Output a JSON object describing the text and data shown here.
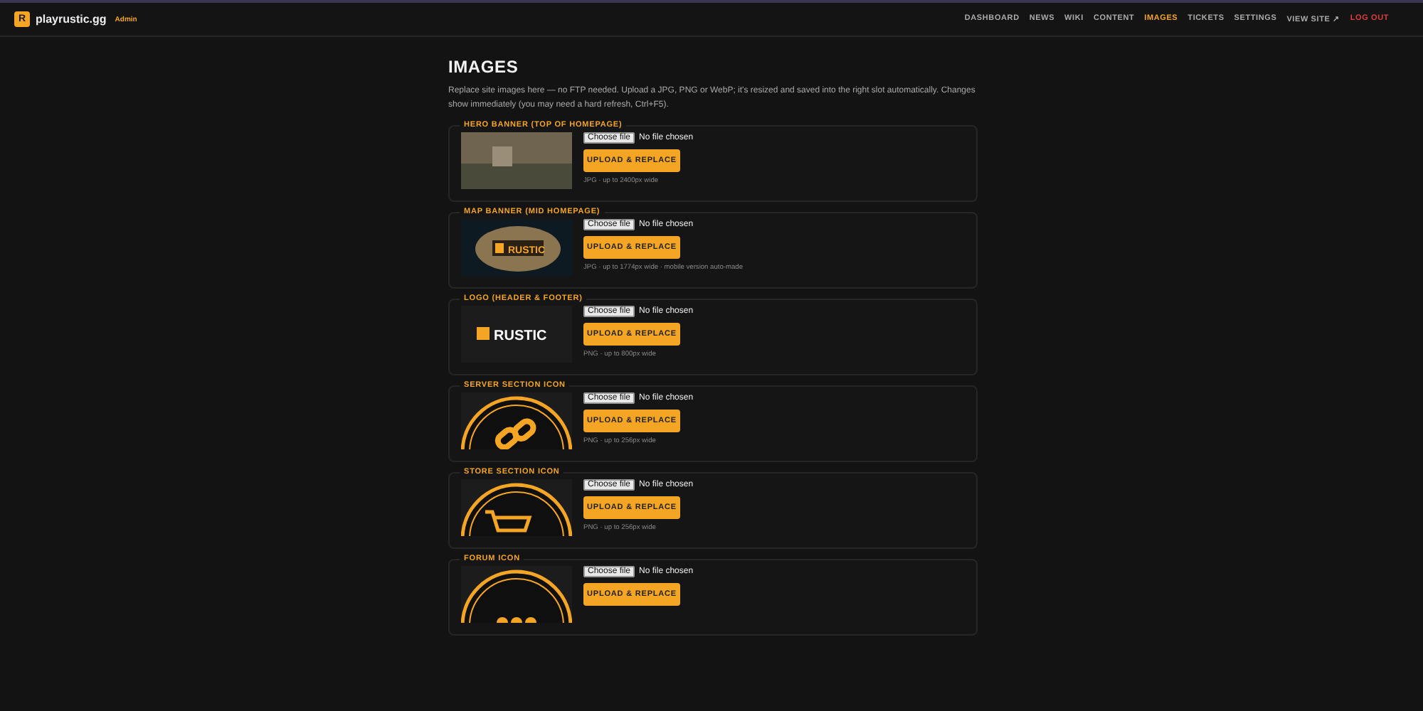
{
  "brand": {
    "logo_letter": "R",
    "name": "playrustic.gg",
    "badge": "Admin"
  },
  "nav": [
    {
      "label": "DASHBOARD",
      "kind": "link",
      "selected": false
    },
    {
      "label": "NEWS",
      "kind": "link",
      "selected": false
    },
    {
      "label": "WIKI",
      "kind": "link",
      "selected": false
    },
    {
      "label": "CONTENT",
      "kind": "link",
      "selected": false
    },
    {
      "label": "IMAGES",
      "kind": "link",
      "selected": true
    },
    {
      "label": "TICKETS",
      "kind": "link",
      "selected": false
    },
    {
      "label": "SETTINGS",
      "kind": "link",
      "selected": false
    },
    {
      "label": "VIEW SITE ↗",
      "kind": "link",
      "selected": false
    },
    {
      "label": "LOG OUT",
      "kind": "logout",
      "selected": false
    }
  ],
  "page": {
    "title": "IMAGES",
    "description": "Replace site images here — no FTP needed. Upload a JPG, PNG or WebP; it's resized and saved into the right slot automatically. Changes show immediately (you may need a hard refresh, Ctrl+F5)."
  },
  "slots": [
    {
      "title": "HERO BANNER (TOP OF HOMEPAGE)",
      "kind": "photo",
      "choose_label": "Choose file",
      "file_status": "No file chosen",
      "button": "UPLOAD & REPLACE",
      "hint": "JPG · up to 2400px wide"
    },
    {
      "title": "MAP BANNER (MID HOMEPAGE)",
      "kind": "map",
      "preview_text": "RUSTIC",
      "choose_label": "Choose file",
      "file_status": "No file chosen",
      "button": "UPLOAD & REPLACE",
      "hint": "JPG · up to 1774px wide · mobile version auto-made"
    },
    {
      "title": "LOGO (HEADER & FOOTER)",
      "kind": "logo",
      "preview_text": "RUSTIC",
      "choose_label": "Choose file",
      "file_status": "No file chosen",
      "button": "UPLOAD & REPLACE",
      "hint": "PNG · up to 800px wide"
    },
    {
      "title": "SERVER SECTION ICON",
      "kind": "chain",
      "choose_label": "Choose file",
      "file_status": "No file chosen",
      "button": "UPLOAD & REPLACE",
      "hint": "PNG · up to 256px wide"
    },
    {
      "title": "STORE SECTION ICON",
      "kind": "cart",
      "choose_label": "Choose file",
      "file_status": "No file chosen",
      "button": "UPLOAD & REPLACE",
      "hint": "PNG · up to 256px wide"
    },
    {
      "title": "FORUM ICON",
      "kind": "dots",
      "choose_label": "Choose file",
      "file_status": "No file chosen",
      "button": "UPLOAD & REPLACE"
    }
  ]
}
